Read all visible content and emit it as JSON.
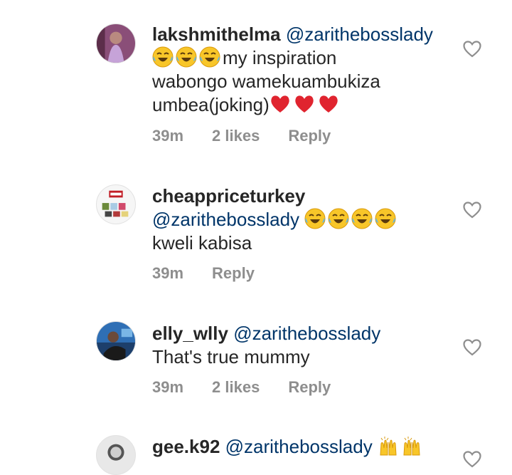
{
  "comments": [
    {
      "username": "lakshmithelma",
      "mention": "@zarithebosslady",
      "line2": "my inspiration",
      "line3": "wabongo wamekuambukiza",
      "line4": "umbea(joking)",
      "time": "39m",
      "likes": "2 likes",
      "reply": "Reply",
      "avatar_icon": "profile-photo-purple",
      "emojis_before": [
        "face-with-tears-of-joy",
        "face-with-tears-of-joy",
        "face-with-tears-of-joy"
      ],
      "emojis_after": [
        "red-heart",
        "red-heart",
        "red-heart"
      ]
    },
    {
      "username": "cheappriceturkey",
      "mention": "@zarithebosslady",
      "line2": "kweli kabisa",
      "time": "39m",
      "reply": "Reply",
      "avatar_icon": "shop-logo",
      "emojis_after": [
        "face-with-tears-of-joy",
        "face-with-tears-of-joy",
        "face-with-tears-of-joy",
        "face-with-tears-of-joy"
      ]
    },
    {
      "username": "elly_wlly",
      "mention": "@zarithebosslady",
      "line2": "That's true mummy",
      "time": "39m",
      "likes": "2 likes",
      "reply": "Reply",
      "avatar_icon": "profile-photo-blue"
    },
    {
      "username": "gee.k92",
      "mention": "@zarithebosslady",
      "avatar_icon": "profile-photo-grey",
      "emojis_after": [
        "raising-hands",
        "raising-hands"
      ]
    }
  ],
  "colors": {
    "text": "#262626",
    "mention": "#003569",
    "meta": "#8e8e8e",
    "heart_outline": "#8e8e8e",
    "emoji_red": "#e0242f"
  },
  "icons": {
    "like": "heart-outline-icon"
  }
}
